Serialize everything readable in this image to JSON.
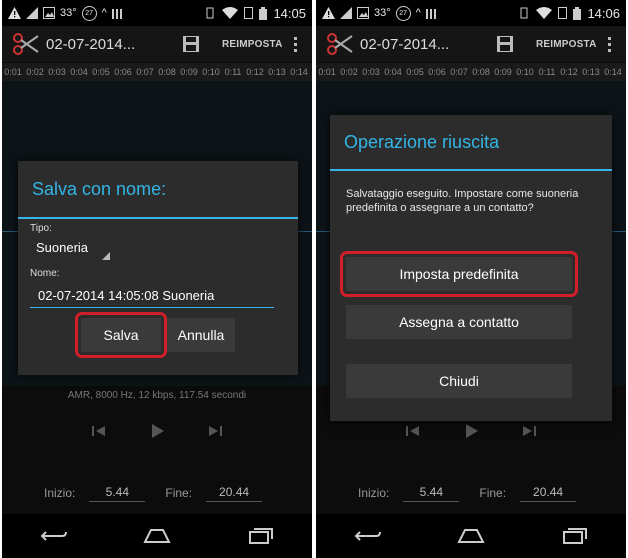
{
  "status_bar": {
    "temperature": "33°",
    "badge": "27",
    "clock_left": "14:05",
    "clock_right": "14:06"
  },
  "action_bar": {
    "title": "02-07-2014...",
    "reset_label": "REIMPOSTA"
  },
  "timeline": [
    "0:01",
    "0:02",
    "0:03",
    "0:04",
    "0:05",
    "0:06",
    "0:07",
    "0:08",
    "0:09",
    "0:10",
    "0:11",
    "0:12",
    "0:13",
    "0:14"
  ],
  "info_line": "AMR, 8000 Hz, 12 kbps, 117.54 secondi",
  "times": {
    "start_label": "Inizio:",
    "start_value": "5.44",
    "end_label": "Fine:",
    "end_value": "20.44"
  },
  "save_dialog": {
    "title": "Salva con nome:",
    "type_label": "Tipo:",
    "type_value": "Suoneria",
    "name_label": "Nome:",
    "name_value": "02-07-2014 14:05:08 Suoneria",
    "save_button": "Salva",
    "cancel_button": "Annulla"
  },
  "success_dialog": {
    "title": "Operazione riuscita",
    "message": "Salvataggio eseguito. Impostare come suoneria predefinita o assegnare a un contatto?",
    "set_default_button": "Imposta predefinita",
    "assign_contact_button": "Assegna a contatto",
    "close_button": "Chiudi"
  },
  "colors": {
    "accent": "#33b5e5",
    "highlight": "#d11f2a",
    "handle": "#d49a20"
  },
  "icons": [
    "warning-icon",
    "image-icon",
    "battery-badge-icon",
    "chevron-up-icon",
    "signal-bars-icon",
    "wifi-icon",
    "battery-icon",
    "scissors-icon",
    "save-icon",
    "overflow-menu-icon",
    "rewind-icon",
    "play-icon",
    "forward-icon",
    "back-icon",
    "home-icon",
    "recents-icon"
  ]
}
